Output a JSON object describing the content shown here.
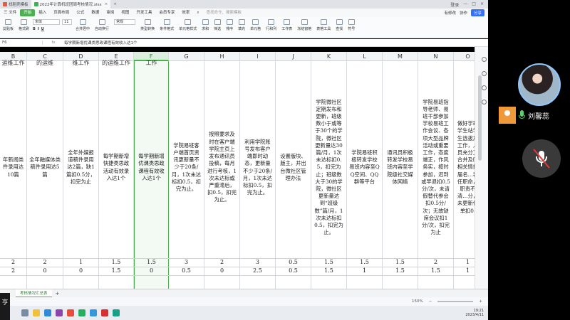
{
  "window": {
    "tabs": [
      {
        "label": "找稻壳模板",
        "color": "#e25b45"
      },
      {
        "label": "2022年计算机班团周考核情况.xlsx",
        "color": "#3fae5a",
        "active": true
      }
    ],
    "login_label": "登录"
  },
  "menu": {
    "items": [
      "三 文件",
      "开始",
      "插入",
      "页面布局",
      "公式",
      "数据",
      "审阅",
      "视图",
      "开发工具",
      "会员专享",
      "效率"
    ],
    "active_index": 1,
    "search_placeholder": "查找命令、搜索模板",
    "right": [
      "有修改",
      "协作",
      "分享"
    ]
  },
  "ribbon": {
    "buttons": [
      "剪贴板",
      "格式刷",
      "合并居中",
      "自动换行",
      "常规",
      "类型转换",
      "条件格式",
      "单元格样式",
      "求和",
      "筛选",
      "排序",
      "填充",
      "单元格",
      "行和列",
      "工作表",
      "冻结窗格",
      "表格工具",
      "查找",
      "符号"
    ],
    "font_name": "宋体",
    "font_size": "11",
    "format_labels": [
      "B",
      "I",
      "U"
    ]
  },
  "formula_bar": {
    "name_box": "F6",
    "fx": "fx",
    "text": "每学期新增优课类思政课程有效收入达1个"
  },
  "columns": [
    {
      "letter": "B",
      "top": "运维工作",
      "main": "年新闻类件录用达10篇",
      "n1": "2",
      "n2": "2"
    },
    {
      "letter": "C",
      "top": "的运维",
      "main": "全年融媒体类稿件录用达5篇",
      "n1": "2",
      "n2": "0"
    },
    {
      "letter": "D",
      "top": "维工作",
      "main": "全年外媒报道稿件录用达2篇，缺1篇扣0.5分，扣完为止",
      "n1": "1",
      "n2": "0"
    },
    {
      "letter": "E",
      "top": "的运维工作",
      "main": "每学期新增快捷类思政活动有效录入达1个",
      "n1": "1.5",
      "n2": "1.5"
    },
    {
      "letter": "F",
      "top": "工作",
      "main": "每学期新增优课类思政课程有效收入达1个",
      "n1": "1.5",
      "n2": "0"
    },
    {
      "letter": "G",
      "top": "",
      "main": "学院易班客户端首页资讯更新量不少于20条/月，1次未达标扣0.5，扣完为止。",
      "n1": "3",
      "n2": "0.5"
    },
    {
      "letter": "H",
      "top": "",
      "main": "按照要求及时在客户端学院主页上发布通讯员投稿，每月进行考核，1次未达标或严重滞后，扣0.5，扣完为止。",
      "n1": "2",
      "n2": "0"
    },
    {
      "letter": "I",
      "top": "",
      "main": "利用学院账号发布客户端即时动态，更新量不少于20条/月，1次未达标扣0.5，扣完为止。",
      "n1": "3",
      "n2": "2.5"
    },
    {
      "letter": "J",
      "top": "",
      "main": "设置版块、版主，并出台微社区管理办法",
      "n1": "0.5",
      "n2": "0.5"
    },
    {
      "letter": "K",
      "top": "",
      "main": "学院微社区定期发布和更新，班级数小于或等于30个的学院，微社区更新量达30篇/月，1次未达标扣0.5，扣完为止；班级数大于30的学院，微社区更新量达到“班级数”篇/月，1次未达标扣0.5，扣完为止。",
      "n1": "1.5",
      "n2": "1.5"
    },
    {
      "letter": "L",
      "top": "",
      "main": "学院易班积极转发学校易班内容至QQ空间、QQ群等平台",
      "n1": "1.5",
      "n2": "1"
    },
    {
      "letter": "M",
      "top": "",
      "main": "通讯员积极转发学校易班内容至学院级社交媒体网络",
      "n1": "1.5",
      "n2": "1.5"
    },
    {
      "letter": "N",
      "top": "",
      "main": "学院易班指导老师、易班干部参加学校易班工作会议、各项大型品牌活动或重要工作，态度端正，作风务实，按时参加，迟到或早退扣0.5分/次，未请假替代参会扣0.5分/次；无故缺席会议扣1分/次，扣完为止",
      "n1": "2",
      "n2": "1.5"
    },
    {
      "letter": "O",
      "top": "",
      "main": "做好学班学生站学生选拔及工作，人员充分工合并及时相关情换届名…表任职命，职责不清…分，未更新任单扣0.",
      "n1": "1",
      "n2": "1"
    }
  ],
  "selected_column": "F",
  "sheets": [
    "考核情况汇总表"
  ],
  "status": {
    "zoom": "150%"
  },
  "taskbar": {
    "time": "19:21",
    "date": "2023/4/11"
  },
  "call": {
    "caller_name": "刘馨蕊"
  }
}
